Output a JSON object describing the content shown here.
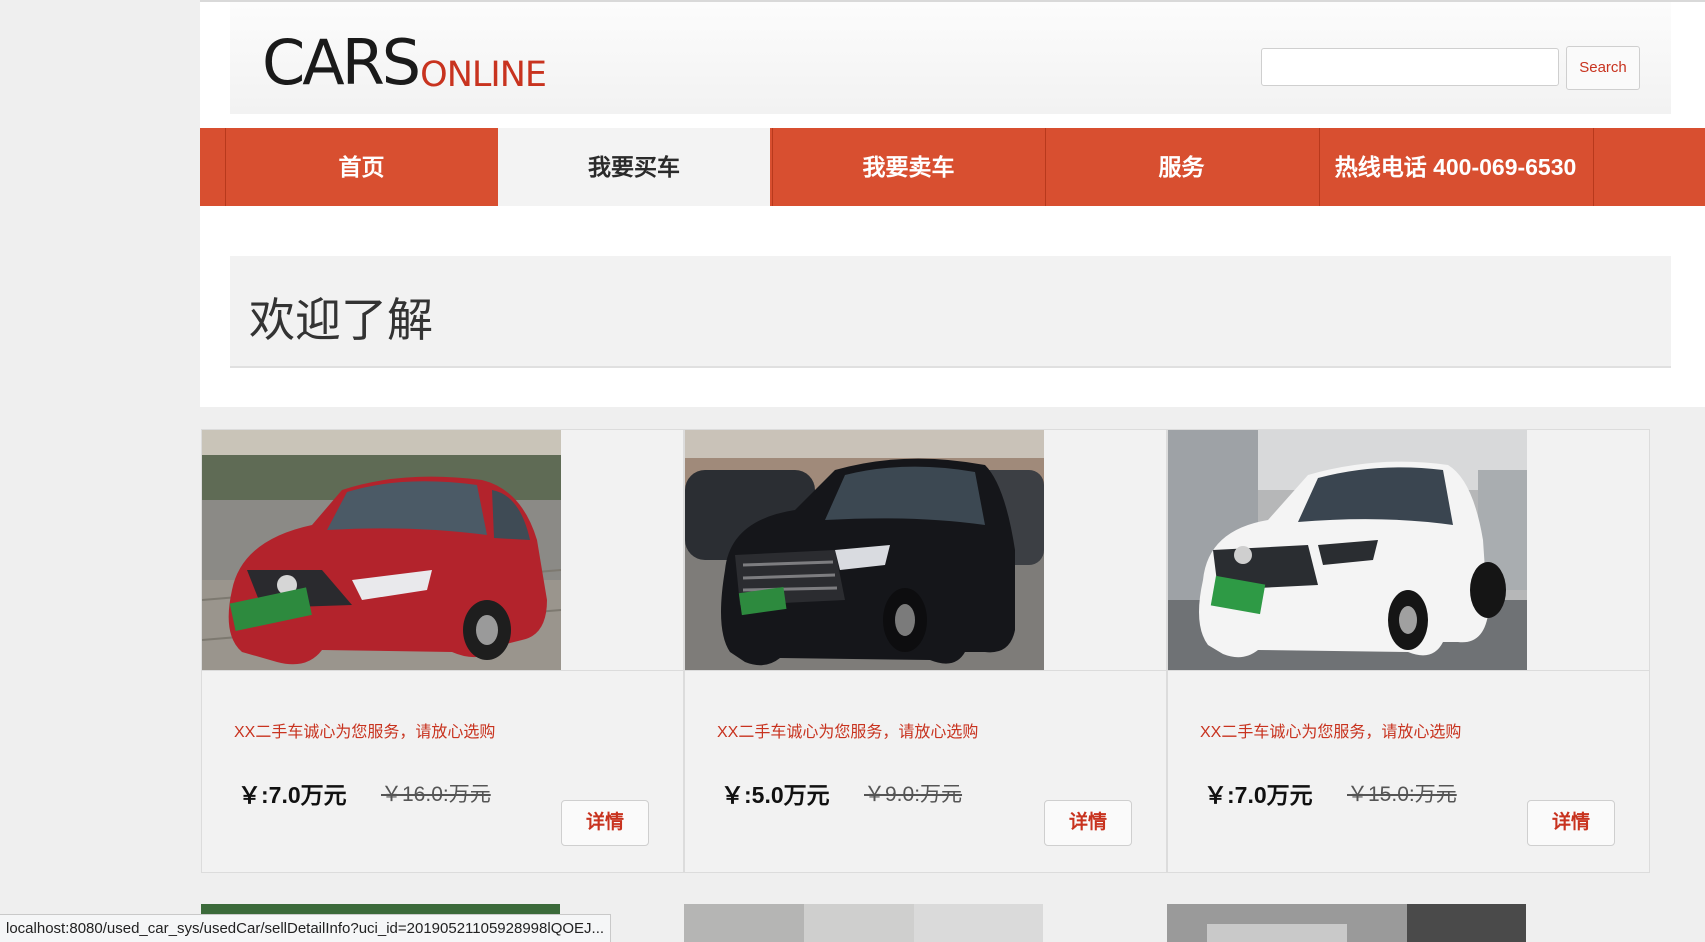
{
  "logo": {
    "main": "CARS",
    "sub": "ONLINE"
  },
  "search": {
    "placeholder": "",
    "value": "",
    "button_label": "Search"
  },
  "nav": {
    "items": [
      {
        "label": "首页",
        "active": false
      },
      {
        "label": "我要买车",
        "active": true
      },
      {
        "label": "我要卖车",
        "active": false
      },
      {
        "label": "服务",
        "active": false
      },
      {
        "label": "热线电话 400-069-6530",
        "active": false
      }
    ]
  },
  "welcome": {
    "title": "欢迎了解"
  },
  "listings": [
    {
      "tagline": "XX二手车诚心为您服务，请放心选购",
      "price": "￥:7.0万元",
      "original_price": "￥16.0:万元",
      "detail_label": "详情",
      "car_color": "red"
    },
    {
      "tagline": "XX二手车诚心为您服务，请放心选购",
      "price": "￥:5.0万元",
      "original_price": "￥9.0:万元",
      "detail_label": "详情",
      "car_color": "black"
    },
    {
      "tagline": "XX二手车诚心为您服务，请放心选购",
      "price": "￥:7.0万元",
      "original_price": "￥15.0:万元",
      "detail_label": "详情",
      "car_color": "white"
    }
  ],
  "status_bar": {
    "url": "localhost:8080/used_car_sys/usedCar/sellDetailInfo?uci_id=20190521105928998lQOEJ..."
  },
  "colors": {
    "accent": "#d84f30",
    "accent_text": "#c8331f",
    "page_bg": "#efefef"
  }
}
